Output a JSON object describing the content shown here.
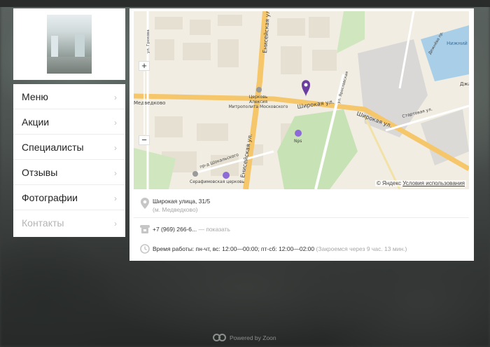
{
  "menu": {
    "items": [
      {
        "label": "Меню",
        "disabled": false
      },
      {
        "label": "Акции",
        "disabled": false
      },
      {
        "label": "Специалисты",
        "disabled": false
      },
      {
        "label": "Отзывы",
        "disabled": false
      },
      {
        "label": "Фотографии",
        "disabled": false
      },
      {
        "label": "Контакты",
        "disabled": true
      }
    ]
  },
  "map": {
    "labels": {
      "street_yeniseyskaya": "Енисейская ул.",
      "street_yeniseyskaya_top": "Енисейская ул.",
      "street_shirokaya_1": "Широкая ул.",
      "street_shirokaya_2": "Широкая ул.",
      "street_startovaya": "Стартовая ул.",
      "street_yaroslavskaya": "ул. Ярославская",
      "street_grekova": "ул. Грекова",
      "street_dezhneva": "Дежнёва пр.",
      "church": "Церковь\nАлексия\nМитрополита Московского",
      "church_l1": "Церковь",
      "church_l2": "Алексия",
      "church_l3": "Митрополита Московского",
      "metro": "Медведково",
      "nps": "Nps",
      "shokalsky": "пр-д Шокальского",
      "serafim": "Серафимовская церковь",
      "nizhny": "Нижний",
      "dzha": "Джа"
    },
    "copyright": "© Яндекс",
    "terms_link": "Условия использования",
    "zoom_plus": "+",
    "zoom_minus": "−"
  },
  "info": {
    "address": "Широкая улица, 31/5",
    "metro": "(м. Медведково)",
    "phone": "+7 (969) 266-6...",
    "phone_show": "— показать",
    "hours": "Время работы: пн-чт, вс: 12:00—00:00; пт-сб: 12:00—02:00",
    "hours_note": "(Закроемся через 9 час. 13 мин.)"
  },
  "footer": {
    "powered": "Powered by Zoon"
  },
  "colors": {
    "pin": "#6b3fa0",
    "road_major": "#f6c66a",
    "card_bg": "#ffffff"
  },
  "icons": {
    "location": "map-pin",
    "phone": "phone",
    "clock": "clock",
    "chevron": "chevron-right"
  }
}
